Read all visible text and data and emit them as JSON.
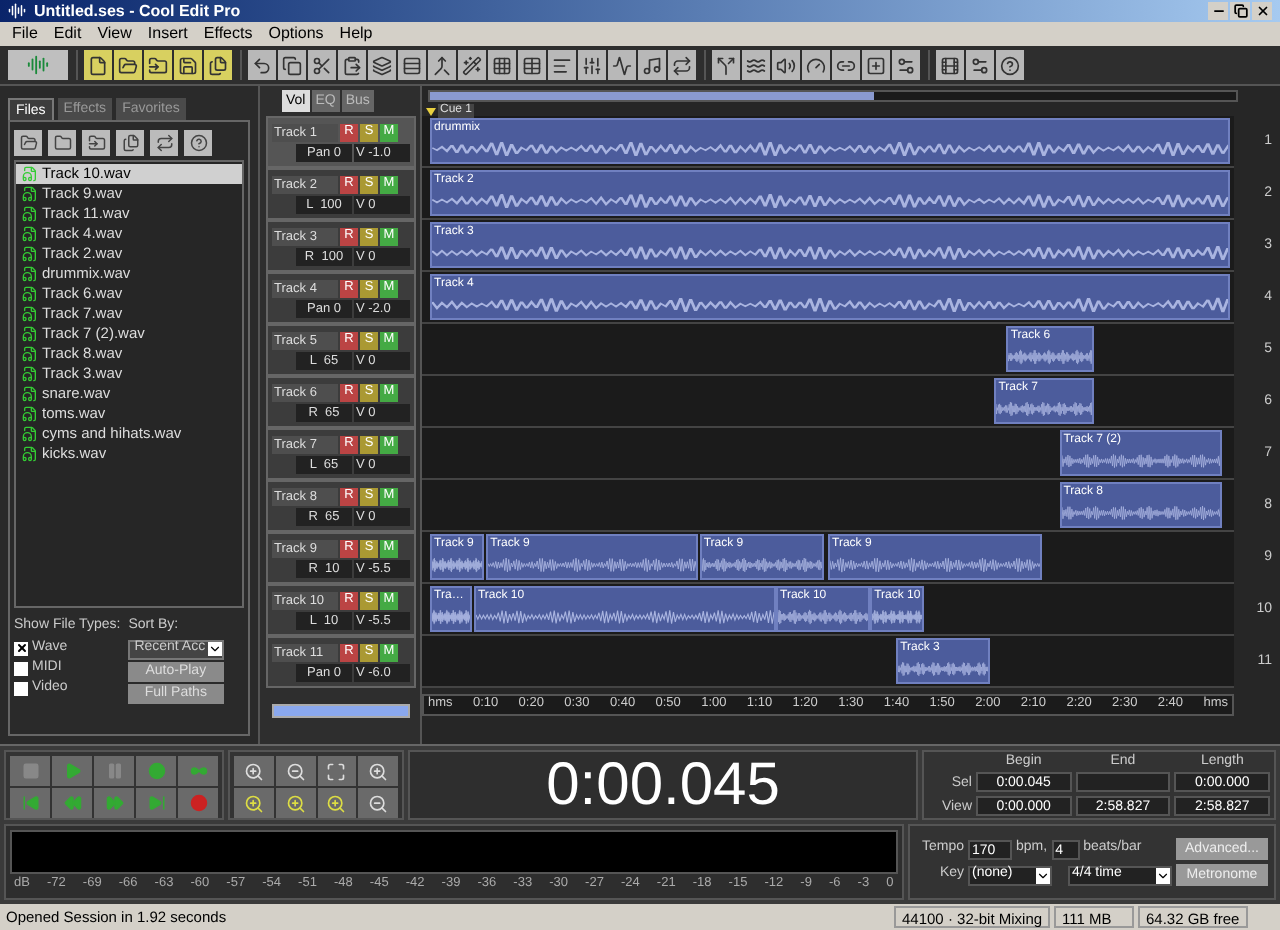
{
  "window": {
    "title": "Untitled.ses - Cool Edit Pro"
  },
  "menu": [
    "File",
    "Edit",
    "View",
    "Insert",
    "Effects",
    "Options",
    "Help"
  ],
  "files_panel": {
    "tabs": [
      {
        "label": "Files",
        "selected": true
      },
      {
        "label": "Effects",
        "selected": false
      },
      {
        "label": "Favorites",
        "selected": false
      }
    ],
    "files": [
      {
        "name": "Track 10.wav",
        "selected": true
      },
      {
        "name": "Track 9.wav",
        "selected": false
      },
      {
        "name": "Track 11.wav",
        "selected": false
      },
      {
        "name": "Track 4.wav",
        "selected": false
      },
      {
        "name": "Track 2.wav",
        "selected": false
      },
      {
        "name": "drummix.wav",
        "selected": false
      },
      {
        "name": "Track 6.wav",
        "selected": false
      },
      {
        "name": "Track 7.wav",
        "selected": false
      },
      {
        "name": "Track 7 (2).wav",
        "selected": false
      },
      {
        "name": "Track 8.wav",
        "selected": false
      },
      {
        "name": "Track 3.wav",
        "selected": false
      },
      {
        "name": "snare.wav",
        "selected": false
      },
      {
        "name": "toms.wav",
        "selected": false
      },
      {
        "name": "cyms and hihats.wav",
        "selected": false
      },
      {
        "name": "kicks.wav",
        "selected": false
      }
    ],
    "show_file_types": {
      "label": "Show File Types:",
      "types": [
        {
          "label": "Wave",
          "checked": true
        },
        {
          "label": "MIDI",
          "checked": false
        },
        {
          "label": "Video",
          "checked": false
        }
      ]
    },
    "sort_by": {
      "label": "Sort By:",
      "value": "Recent Acc"
    },
    "buttons": [
      "Auto-Play",
      "Full Paths"
    ]
  },
  "track_tabs": [
    {
      "label": "Vol",
      "selected": true
    },
    {
      "label": "EQ",
      "selected": false
    },
    {
      "label": "Bus",
      "selected": false
    }
  ],
  "tracks": [
    {
      "name": "Track 1",
      "selected": true,
      "pan": "Pan 0",
      "volume": "V -1.0",
      "number": "1",
      "clips": [
        "drummix"
      ]
    },
    {
      "name": "Track 2",
      "selected": false,
      "pan": "L  100",
      "volume": "V 0",
      "number": "2",
      "clips": [
        "Track 2"
      ]
    },
    {
      "name": "Track 3",
      "selected": false,
      "pan": "R  100",
      "volume": "V 0",
      "number": "3",
      "clips": [
        "Track 3"
      ]
    },
    {
      "name": "Track 4",
      "selected": false,
      "pan": "Pan 0",
      "volume": "V -2.0",
      "number": "4",
      "clips": [
        "Track 4"
      ]
    },
    {
      "name": "Track 5",
      "selected": false,
      "pan": "L  65",
      "volume": "V 0",
      "number": "5",
      "clips": [
        "Track 6"
      ]
    },
    {
      "name": "Track 6",
      "selected": false,
      "pan": "R  65",
      "volume": "V 0",
      "number": "6",
      "clips": [
        "Track 7"
      ]
    },
    {
      "name": "Track 7",
      "selected": false,
      "pan": "L  65",
      "volume": "V 0",
      "number": "7",
      "clips": [
        "Track 7 (2)"
      ]
    },
    {
      "name": "Track 8",
      "selected": false,
      "pan": "R  65",
      "volume": "V 0",
      "number": "8",
      "clips": [
        "Track 8"
      ]
    },
    {
      "name": "Track 9",
      "selected": false,
      "pan": "R  10",
      "volume": "V -5.5",
      "number": "9",
      "clips": [
        "Track 9",
        "Track 9",
        "Track 9",
        "Track 9"
      ]
    },
    {
      "name": "Track 10",
      "selected": false,
      "pan": "L  10",
      "volume": "V -5.5",
      "number": "10",
      "clips": [
        "Tra…",
        "Track 10",
        "Track 10",
        "Track 10"
      ]
    },
    {
      "name": "Track 11",
      "selected": false,
      "pan": "Pan 0",
      "volume": "V -6.0",
      "number": "11",
      "clips": [
        "Track 3"
      ]
    }
  ],
  "track_buttons": [
    [
      "R",
      "S",
      "M"
    ],
    [
      "R",
      "S",
      "M"
    ],
    [
      "R",
      "S",
      "M"
    ],
    [
      "R",
      "S",
      "M"
    ],
    [
      "R",
      "S",
      "M"
    ],
    [
      "R",
      "S",
      "M"
    ],
    [
      "R",
      "S",
      "M"
    ],
    [
      "R",
      "S",
      "M"
    ],
    [
      "R",
      "S",
      "M"
    ],
    [
      "R",
      "S",
      "M"
    ],
    [
      "R",
      "S",
      "M"
    ]
  ],
  "cue": "Cue 1",
  "ruler": [
    "hms",
    "0:10",
    "0:20",
    "0:30",
    "0:40",
    "0:50",
    "1:00",
    "1:10",
    "1:20",
    "1:30",
    "1:40",
    "1:50",
    "2:00",
    "2:10",
    "2:20",
    "2:30",
    "2:40",
    "hms"
  ],
  "time_display": "0:00.045",
  "selection": {
    "columns": [
      "Begin",
      "End",
      "Length"
    ],
    "rows": [
      {
        "label": "Sel",
        "begin": "0:00.045",
        "length": "0:00.000"
      },
      {
        "label": "View",
        "begin": "0:00.000",
        "end": "2:58.827",
        "length": "2:58.827"
      }
    ]
  },
  "meter_scale": [
    "dB",
    "-72",
    "-69",
    "-66",
    "-63",
    "-60",
    "-57",
    "-54",
    "-51",
    "-48",
    "-45",
    "-42",
    "-39",
    "-36",
    "-33",
    "-30",
    "-27",
    "-24",
    "-21",
    "-18",
    "-15",
    "-12",
    "-9",
    "-6",
    "-3",
    "0"
  ],
  "tempo": {
    "label": "Tempo",
    "bpm": "170",
    "bpm_unit": "bpm,",
    "beats": "4",
    "beats_unit": "beats/bar",
    "key_label": "Key",
    "key": "(none)",
    "time_signature": "4/4 time",
    "buttons": [
      "Advanced...",
      "Metronome"
    ]
  },
  "status_bar": [
    "Opened Session in 1.92 seconds",
    "44100 · 32-bit Mixing",
    "111 MB",
    "64.32 GB free"
  ]
}
